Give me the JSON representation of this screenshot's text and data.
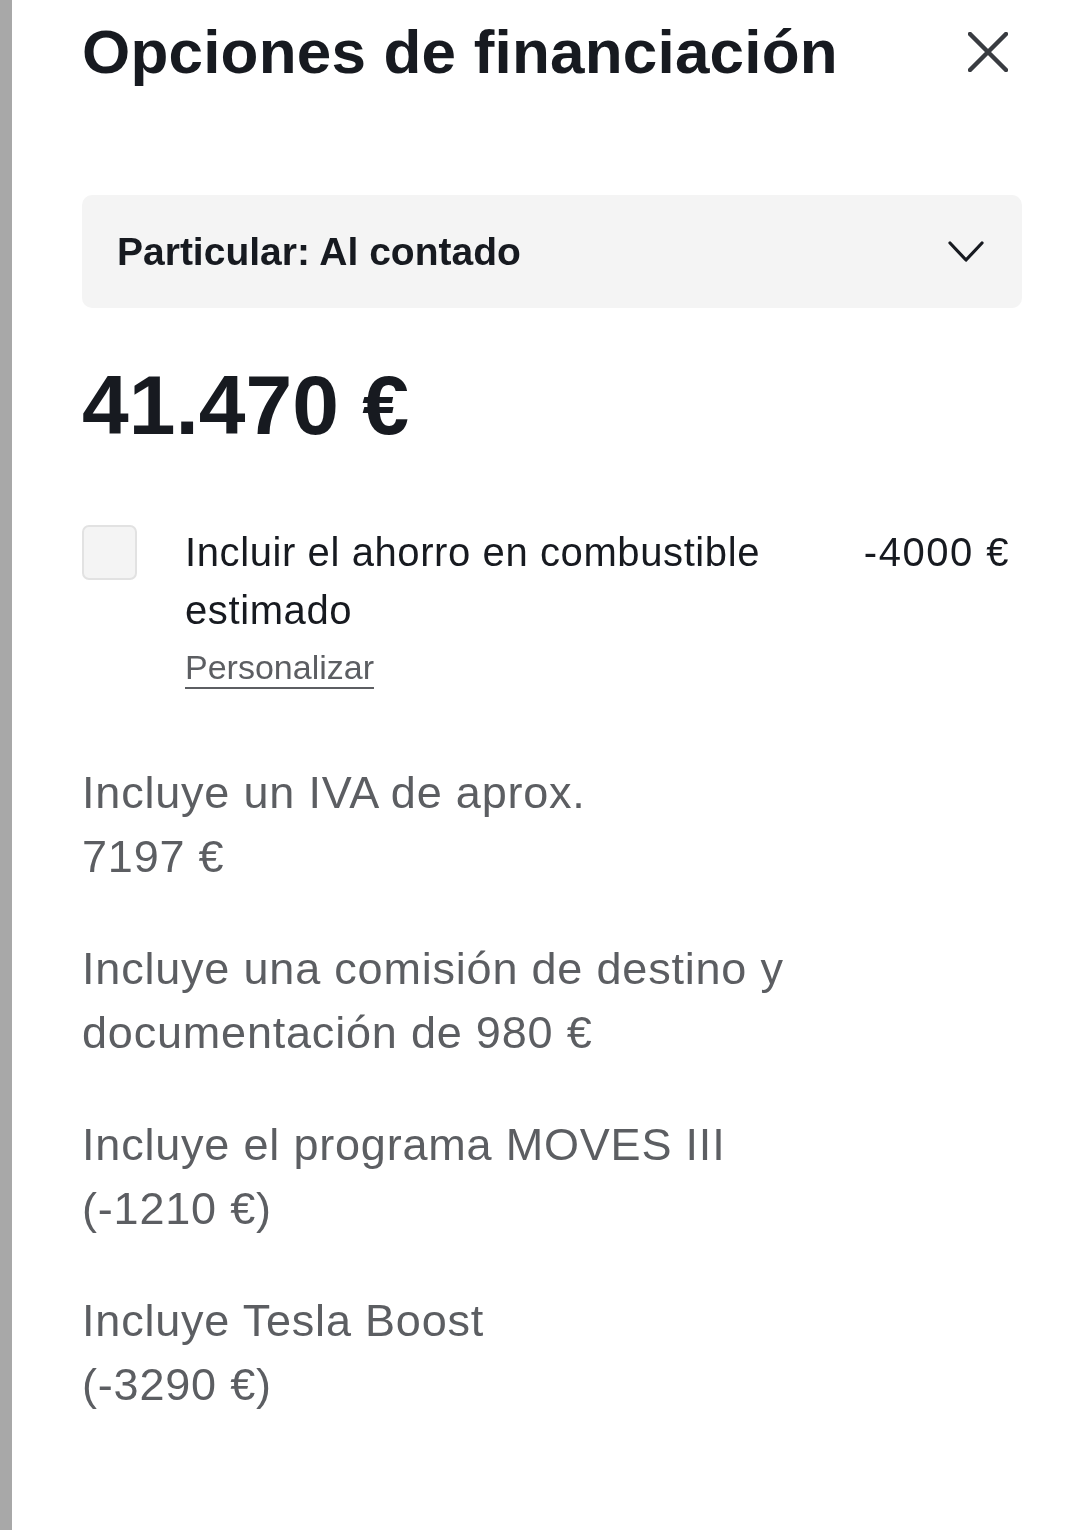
{
  "dialog": {
    "title": "Opciones de financiación"
  },
  "financing_select": {
    "value": "Particular: Al contado"
  },
  "price": "41.470 €",
  "fuel_savings": {
    "label": "Incluir el ahorro en combustible estimado",
    "amount": "-4000 €",
    "checked": false,
    "link": "Personalizar"
  },
  "notes": [
    {
      "text": "Incluye un IVA de aprox.",
      "amount": "7197 €"
    },
    {
      "text": "Incluye una comisión de destino y documentación de 980 €"
    },
    {
      "text": "Incluye el programa MOVES III",
      "amount": "(-1210 €)"
    },
    {
      "text": "Incluye Tesla Boost",
      "amount": "(-3290 €)"
    }
  ]
}
